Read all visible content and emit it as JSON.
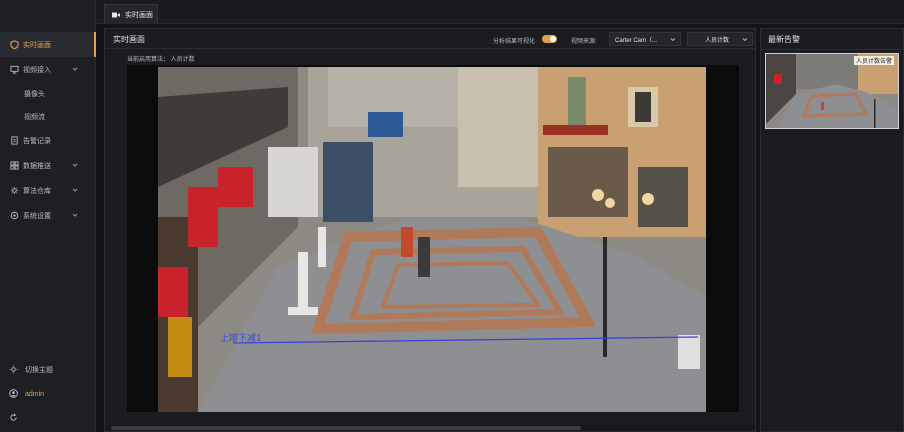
{
  "sidebar": {
    "items": [
      {
        "label": "实时画面",
        "icon": "shield-icon",
        "active": true
      },
      {
        "label": "视频接入",
        "icon": "monitor-icon",
        "expandable": true
      },
      {
        "label": "摄像头",
        "sub": true
      },
      {
        "label": "视频流",
        "sub": true
      },
      {
        "label": "告警记录",
        "icon": "document-icon"
      },
      {
        "label": "数据推送",
        "icon": "grid-icon",
        "expandable": true
      },
      {
        "label": "算法仓库",
        "icon": "gear-icon",
        "expandable": true
      },
      {
        "label": "系统设置",
        "icon": "settings-icon",
        "expandable": true
      }
    ],
    "switch_theme": "切换主题",
    "user": "admin",
    "accent": "#e0a14a"
  },
  "tabs": [
    {
      "label": "实时画面",
      "icon": "video-icon"
    }
  ],
  "main": {
    "title": "实时画面",
    "toggle_label": "分析结果可视化",
    "toggle_on": true,
    "source_label": "视频来源:",
    "source_value": "Carter Cam（...",
    "algorithm_value": "人员计数",
    "current_algorithm": "当前启用算法：  人员计数",
    "video": {
      "line_label": "上增下减1"
    }
  },
  "alerts": {
    "title": "最新告警",
    "items": [
      {
        "badge": "人员计数告警"
      }
    ]
  }
}
